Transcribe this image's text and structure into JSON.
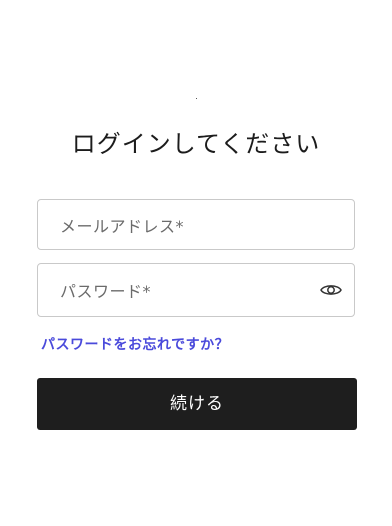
{
  "login": {
    "title": "ログインしてください",
    "email_placeholder": "メールアドレス*",
    "password_placeholder": "パスワード*",
    "forgot_password": "パスワードをお忘れですか？",
    "continue_label": "続ける"
  },
  "colors": {
    "link": "#4a4adb",
    "button_bg": "#1e1e1e",
    "border": "#c9c9c9"
  },
  "icons": {
    "password_toggle": "eye-icon"
  }
}
